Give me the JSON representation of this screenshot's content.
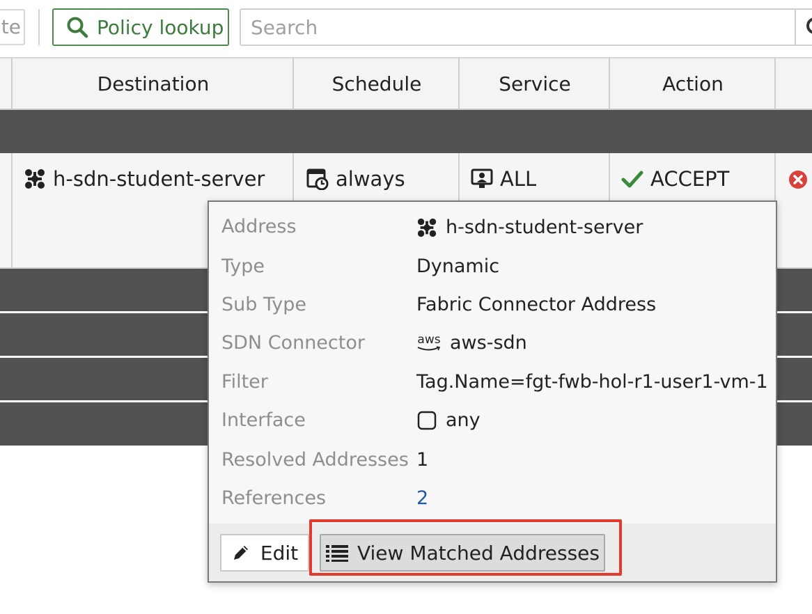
{
  "toolbar": {
    "partial_button_text": "te",
    "policy_lookup_label": "Policy lookup",
    "search_placeholder": "Search"
  },
  "table": {
    "columns": [
      "Destination",
      "Schedule",
      "Service",
      "Action"
    ],
    "row": {
      "destination": "h-sdn-student-server",
      "schedule": "always",
      "service": "ALL",
      "action": "ACCEPT"
    }
  },
  "popup": {
    "rows": [
      {
        "label": "Address",
        "value": "h-sdn-student-server",
        "icon": "sdn-address-icon"
      },
      {
        "label": "Type",
        "value": "Dynamic"
      },
      {
        "label": "Sub Type",
        "value": "Fabric Connector Address"
      },
      {
        "label": "SDN Connector",
        "value": "aws-sdn",
        "icon": "aws-icon",
        "icon_text": "aws"
      },
      {
        "label": "Filter",
        "value": "Tag.Name=fgt-fwb-hol-r1-user1-vm-1"
      },
      {
        "label": "Interface",
        "value": "any",
        "icon": "interface-icon"
      },
      {
        "label": "Resolved Addresses",
        "value": "1"
      },
      {
        "label": "References",
        "value": "2"
      }
    ],
    "edit_label": "Edit",
    "view_matched_label": "View Matched Addresses"
  },
  "colors": {
    "accent_green": "#3b7b3b",
    "group_row": "#525252",
    "highlight_red": "#e23b2e",
    "link_blue": "#1f5aa0",
    "deny_red": "#d9413a"
  }
}
